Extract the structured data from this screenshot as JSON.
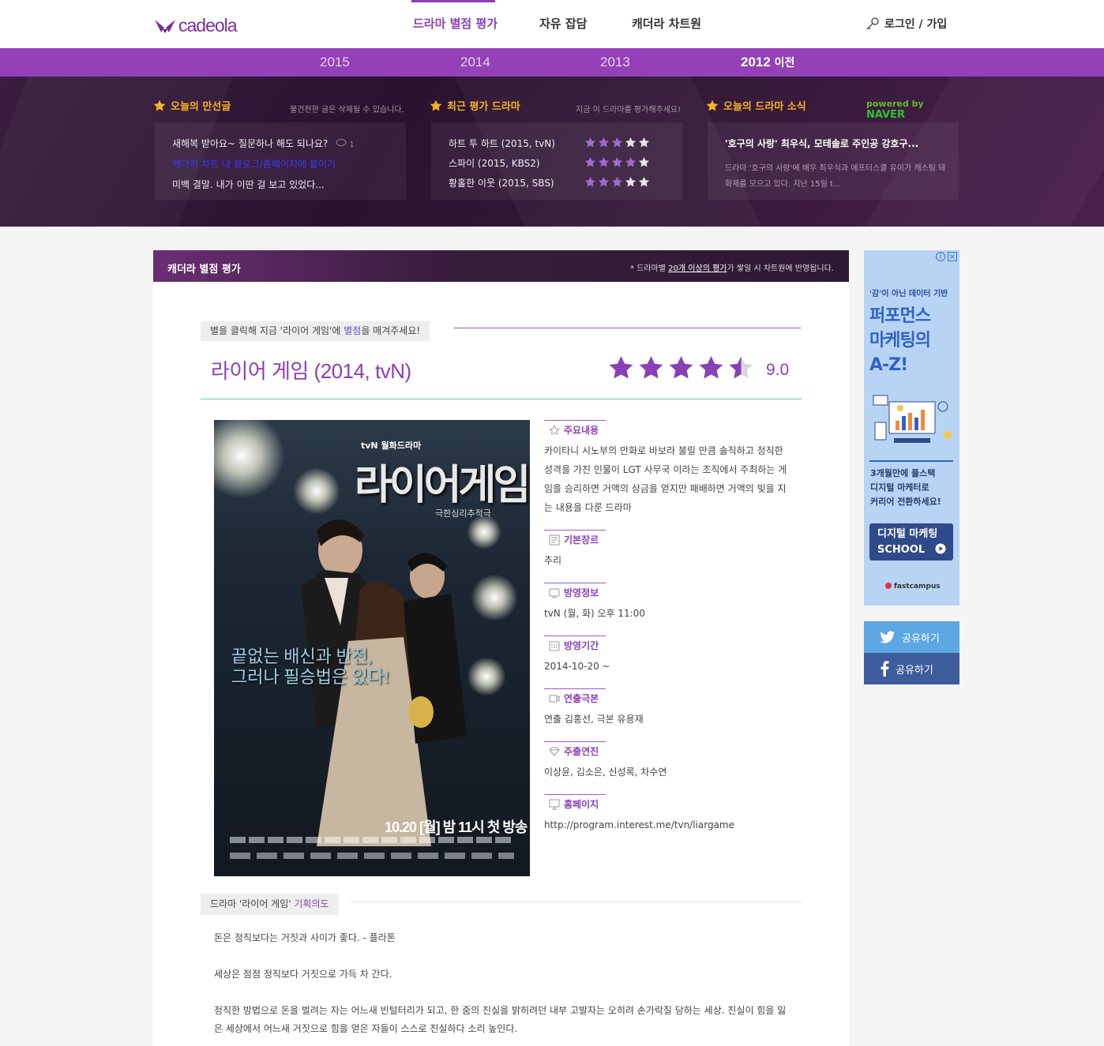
{
  "header": {
    "logo_text": "cadeola",
    "nav": [
      {
        "label": "드라마 별점 평가"
      },
      {
        "label": "자유 잡담"
      },
      {
        "label": "캐더라 차트원"
      }
    ],
    "login_label": "로그인 / 가입"
  },
  "years": {
    "y2015": "2015",
    "y2014": "2014",
    "y2013": "2013",
    "y2012": "2012",
    "y2012_suffix": "이전"
  },
  "banner": {
    "board": {
      "title": "오늘의 만선글",
      "note": "불건전한 글은 삭제될 수 있습니다.",
      "items": [
        {
          "text": "새해복 받아요~ 질문하나 해도 되나요?",
          "comments": "1"
        },
        {
          "text": "캐더라 차트 내 블로그/홈페이지에 붙이기"
        },
        {
          "text": "미백 결말. 내가 이딴 걸 보고 있었다..."
        }
      ]
    },
    "recent": {
      "title": "최근 평가 드라마",
      "note": "지금 이 드라마를 평가해주세요!",
      "items": [
        {
          "text": "하트 투 하트 (2015, tvN)",
          "stars": 3
        },
        {
          "text": "스파이 (2015, KBS2)",
          "stars": 4
        },
        {
          "text": "황홀한 이웃 (2015, SBS)",
          "stars": 3
        }
      ]
    },
    "news": {
      "title": "오늘의 드라마 소식",
      "powered_by": "powered by",
      "naver": "NAVER",
      "headline": "'호구의 사랑' 최우식, 모테솔로 주인공 강호구...",
      "summary": "드라마 '호구의 사랑'에 배우 최우식과 에프터스쿨 유이가 캐스팅 돼 화제를 모으고 있다. 지난 15일 t..."
    }
  },
  "panel": {
    "title": "캐더라 별점 평가",
    "note_prefix": "* 드라마별",
    "note_link": "20개 이상의 평가",
    "note_suffix": "가 쌓일 시 차트원에 반영됩니다.",
    "prompt_a": "별을 클릭해 지금 '라이어 게임'에",
    "prompt_hl": "별점",
    "prompt_b": "을 매겨주세요!",
    "drama_title": "라이어 게임 (2014, tvN)",
    "rating_stars": 4.5,
    "score": "9.0"
  },
  "poster": {
    "channel": "tvN 월화드라마",
    "title": "라이어게임",
    "subtitle": "극한심리추적극",
    "slogan_1": "끝없는 배신과 반전,",
    "slogan_2": "그러나 필승법은 있다!",
    "air_date": "10.20 [월] 밤 11시 첫 방송"
  },
  "info": {
    "synopsis": {
      "label": "주요내용",
      "text": "카이타니 시노부의 만화로 바보라 불릴 만큼 솔직하고 정직한 성격을 가진 인물이 LGT 사무국 이라는 조직에서 주최하는 게임을 승리하면 거액의 상금을 얻지만 패배하면 거액의 빚을 지는 내용을 다룬 드라마"
    },
    "genre": {
      "label": "기본장르",
      "text": "추리"
    },
    "broadcast": {
      "label": "방영정보",
      "text": "tvN (월, 화) 오후 11:00"
    },
    "period": {
      "label": "방영기간",
      "text": "2014-10-20 ~"
    },
    "staff": {
      "label": "연출극본",
      "text": "연출 김홍선, 극본 유용재"
    },
    "cast": {
      "label": "주출연진",
      "text": "이상윤, 김소은, 신성록, 차수연"
    },
    "homepage": {
      "label": "홈페이지",
      "text": "http://program.interest.me/tvn/liargame"
    }
  },
  "plan": {
    "tab_a": "드라마 '라이어 게임'",
    "tab_hl": "기획의도",
    "p1": "돈은 정직보다는 거짓과 사이가 좋다. - 플라톤",
    "p2": "세상은 점점 정직보다 거짓으로 가득 차 간다.",
    "p3": "정직한 방법으로 돈을 벌려는 자는 어느새 빈털터리가 되고, 한 줌의 진실을 밝히려던 내부 고발자는 오히려 손가락질 당하는 세상. 진실이 힘을 잃은 세상에서 어느새 거짓으로 힘을 얻은 자들이 스스로 진실하다 소리 높인다."
  },
  "ad": {
    "kicker": "'감'이 아닌 데이터 기반",
    "head_1": "퍼포먼스",
    "head_2": "마케팅의",
    "head_3": "A-Z!",
    "copy_1": "3개월만에 풀스택",
    "copy_2": "디지털 마케터로",
    "copy_3": "커리어 전환하세요!",
    "btn_1": "디지털 마케팅",
    "btn_2": "SCHOOL",
    "brand": "fastcampus"
  },
  "share": {
    "twitter": "공유하기",
    "facebook": "공유하기"
  },
  "colors": {
    "brand_purple": "#8b3fb4",
    "year_bar": "#9440b6",
    "star_gold": "#f5b223",
    "rating_star": "#8b3fb4"
  }
}
